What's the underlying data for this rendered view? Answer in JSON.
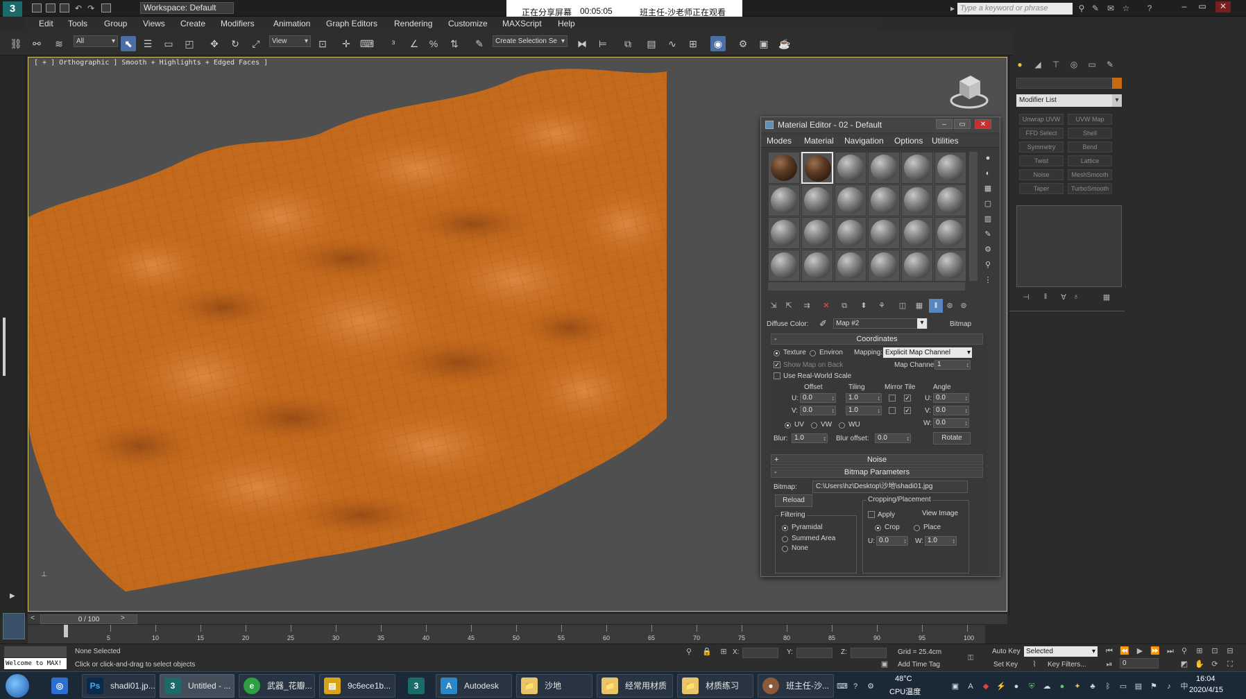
{
  "titlebar": {
    "app_icon": "3",
    "workspace": "Workspace: Default",
    "share_status": "正在分享屏幕",
    "share_time": "00:05:05",
    "share_viewer": "班主任-沙老师正在观看",
    "search_placeholder": "Type a keyword or phrase"
  },
  "menubar": [
    "Edit",
    "Tools",
    "Group",
    "Views",
    "Create",
    "Modifiers",
    "Animation",
    "Graph Editors",
    "Rendering",
    "Customize",
    "MAXScript",
    "Help"
  ],
  "toolbar": {
    "filter": "All",
    "ref_coord": "View",
    "selection_set": "Create Selection Se"
  },
  "viewport": {
    "label": "[ + ] Orthographic ] Smooth + Highlights + Edged Faces ]",
    "terrain_color": "#c46a1d"
  },
  "command_panel": {
    "modifier_list": "Modifier List",
    "modifier_buttons": [
      "Unwrap UVW",
      "UVW Map",
      "FFD Select",
      "Shell",
      "Symmetry",
      "Bend",
      "Twist",
      "Lattice",
      "Noise",
      "MeshSmooth",
      "Taper",
      "TurboSmooth"
    ]
  },
  "material_editor": {
    "title": "Material Editor - 02 - Default",
    "menu": [
      "Modes",
      "Material",
      "Navigation",
      "Options",
      "Utilities"
    ],
    "diffuse_label": "Diffuse Color:",
    "map_name": "Map #2",
    "map_type": "Bitmap",
    "coordinates": {
      "header": "Coordinates",
      "texture": "Texture",
      "environ": "Environ",
      "mapping_label": "Mapping:",
      "mapping_value": "Explicit Map Channel",
      "show_map": "Show Map on Back",
      "map_channel_label": "Map Channel:",
      "map_channel": "1",
      "real_world": "Use Real-World Scale",
      "offset": "Offset",
      "tiling": "Tiling",
      "mirror_tile": "Mirror Tile",
      "angle": "Angle",
      "u_label": "U:",
      "v_label": "V:",
      "w_label": "W:",
      "u_offset": "0.0",
      "v_offset": "0.0",
      "u_tiling": "1.0",
      "v_tiling": "1.0",
      "u_angle": "0.0",
      "v_angle": "0.0",
      "w_angle": "0.0",
      "uv": "UV",
      "vw": "VW",
      "wu": "WU",
      "blur_label": "Blur:",
      "blur": "1.0",
      "blur_offset_label": "Blur offset:",
      "blur_offset": "0.0",
      "rotate": "Rotate"
    },
    "noise_header": "Noise",
    "bitmap_params": {
      "header": "Bitmap Parameters",
      "bitmap_label": "Bitmap:",
      "bitmap_path": "C:\\Users\\hz\\Desktop\\沙地\\shadi01.jpg",
      "reload": "Reload",
      "cropping": "Cropping/Placement",
      "apply": "Apply",
      "view_image": "View Image",
      "crop": "Crop",
      "place": "Place",
      "u_label": "U:",
      "u_value": "0.0",
      "w_label": "W:",
      "w_value": "1.0",
      "filtering": "Filtering",
      "pyramidal": "Pyramidal",
      "summed": "Summed Area",
      "none": "None"
    }
  },
  "timeline": {
    "frame": "0 / 100",
    "ticks": [
      "5",
      "10",
      "15",
      "20",
      "25",
      "30",
      "35",
      "40",
      "45",
      "50",
      "55",
      "60",
      "65",
      "70",
      "75",
      "80",
      "85",
      "90",
      "95",
      "100"
    ]
  },
  "statusbar": {
    "maxscript": "Welcome to MAX!",
    "selection": "None Selected",
    "prompt": "Click or click-and-drag to select objects",
    "x_label": "X:",
    "y_label": "Y:",
    "z_label": "Z:",
    "grid": "Grid = 25.4cm",
    "add_time_tag": "Add Time Tag",
    "auto_key": "Auto Key",
    "set_key": "Set Key",
    "selected": "Selected",
    "key_filters": "Key Filters...",
    "frame_field": "0"
  },
  "taskbar": {
    "items": [
      {
        "label": "shadi01.jp...",
        "icon": "Ps"
      },
      {
        "label": "Untitled - ...",
        "icon": "3"
      },
      {
        "label": "武器_花瓣...",
        "icon": "e"
      },
      {
        "label": "9c6ece1b...",
        "icon": "▤"
      },
      {
        "label": "Autodesk",
        "icon": "A"
      },
      {
        "label": "沙地",
        "icon": "📁"
      },
      {
        "label": "经常用材质",
        "icon": "📁"
      },
      {
        "label": "材质练习",
        "icon": "📁"
      },
      {
        "label": "班主任-沙...",
        "icon": "●"
      }
    ],
    "temp": "48°C",
    "temp_label": "CPU温度",
    "time": "16:04",
    "date": "2020/4/15"
  }
}
